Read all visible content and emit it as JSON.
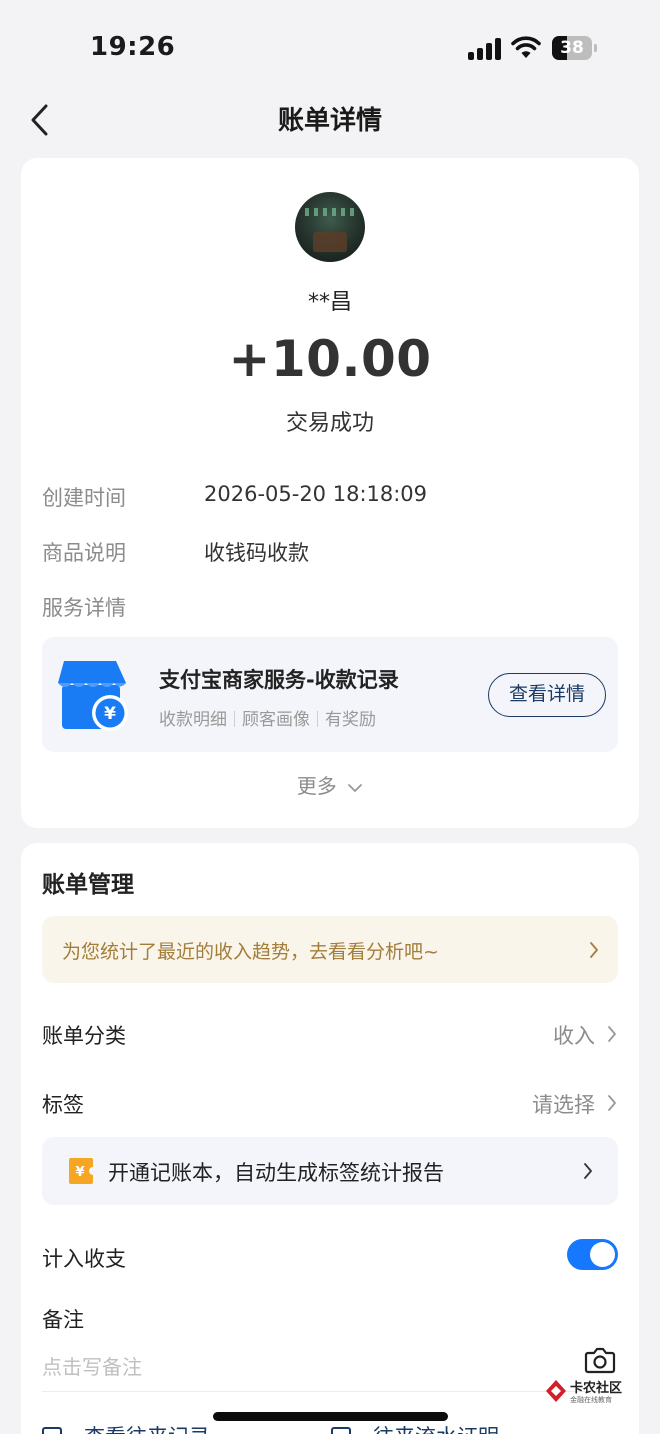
{
  "status_bar": {
    "time": "19:26",
    "battery": "38",
    "battery_level": 0.38
  },
  "nav": {
    "title": "账单详情",
    "back_icon": "chevron-left-icon"
  },
  "transaction": {
    "payer_name": "**昌",
    "amount": "+10.00",
    "status": "交易成功"
  },
  "details": {
    "rows": [
      {
        "label": "创建时间",
        "value": "2026-05-20 18:18:09"
      },
      {
        "label": "商品说明",
        "value": "收钱码收款"
      }
    ],
    "service_label": "服务详情"
  },
  "service_card": {
    "icon": "shop-yuan-icon",
    "title": "支付宝商家服务-收款记录",
    "tags": [
      "收款明细",
      "顾客画像",
      "有奖励"
    ],
    "button": "查看详情"
  },
  "more": {
    "label": "更多"
  },
  "bill_management": {
    "title": "账单管理",
    "trend_banner": "为您统计了最近的收入趋势，去看看分析吧~",
    "category": {
      "label": "账单分类",
      "value": "收入"
    },
    "tags": {
      "label": "标签",
      "value": "请选择"
    },
    "ledger_banner": "开通记账本，自动生成标签统计报告",
    "count_in_budget": {
      "label": "计入收支",
      "enabled": true
    },
    "note": {
      "label": "备注",
      "placeholder": "点击写备注"
    },
    "bottom_links": [
      "查看往来记录",
      "往来流水证明"
    ]
  },
  "watermark": {
    "title": "卡农社区",
    "subtitle": "金融在线教育"
  },
  "colors": {
    "accent_blue": "#1677ff",
    "dark_blue": "#1b3a64",
    "trend_text": "#a37d3a",
    "trend_bg": "#faf5ea",
    "shop_icon": "#1a7cf5"
  }
}
